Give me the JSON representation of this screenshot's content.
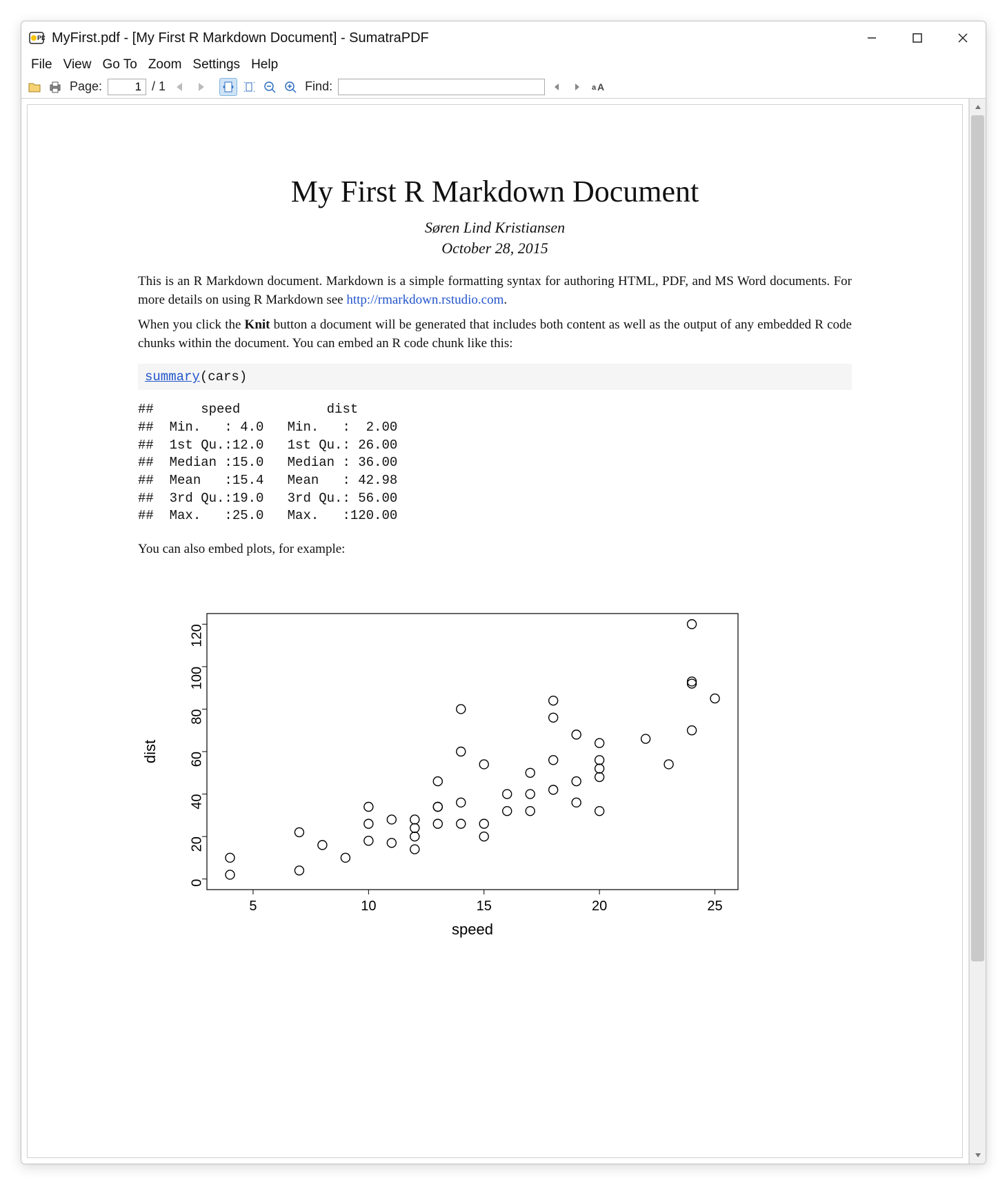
{
  "window": {
    "title": "MyFirst.pdf - [My First R Markdown Document] - SumatraPDF"
  },
  "menu": {
    "file": "File",
    "view": "View",
    "goto": "Go To",
    "zoom": "Zoom",
    "settings": "Settings",
    "help": "Help"
  },
  "toolbar": {
    "page_label": "Page:",
    "page_current": "1",
    "page_total": "/ 1",
    "find_label": "Find:",
    "find_value": ""
  },
  "doc": {
    "title": "My First R Markdown Document",
    "author": "Søren Lind Kristiansen",
    "date": "October 28, 2015",
    "p1a": "This is an R Markdown document. Markdown is a simple formatting syntax for authoring HTML, PDF, and MS Word documents. For more details on using R Markdown see ",
    "link_text": "http://rmarkdown.rstudio.com",
    "p1b": ".",
    "p2a": "When you click the ",
    "knit": "Knit",
    "p2b": " button a document will be generated that includes both content as well as the output of any embedded R code chunks within the document. You can embed an R code chunk like this:",
    "code_fn": "summary",
    "code_rest": "(cars)",
    "output": "##      speed           dist\n##  Min.   : 4.0   Min.   :  2.00\n##  1st Qu.:12.0   1st Qu.: 26.00\n##  Median :15.0   Median : 36.00\n##  Mean   :15.4   Mean   : 42.98\n##  3rd Qu.:19.0   3rd Qu.: 56.00\n##  Max.   :25.0   Max.   :120.00",
    "p3": "You can also embed plots, for example:"
  },
  "chart_data": {
    "type": "scatter",
    "xlabel": "speed",
    "ylabel": "dist",
    "xlim": [
      3,
      26
    ],
    "ylim": [
      -5,
      125
    ],
    "xticks": [
      5,
      10,
      15,
      20,
      25
    ],
    "yticks": [
      0,
      20,
      40,
      60,
      80,
      100,
      120
    ],
    "points": [
      {
        "x": 4,
        "y": 2
      },
      {
        "x": 4,
        "y": 10
      },
      {
        "x": 7,
        "y": 4
      },
      {
        "x": 7,
        "y": 22
      },
      {
        "x": 8,
        "y": 16
      },
      {
        "x": 9,
        "y": 10
      },
      {
        "x": 10,
        "y": 18
      },
      {
        "x": 10,
        "y": 26
      },
      {
        "x": 10,
        "y": 34
      },
      {
        "x": 11,
        "y": 17
      },
      {
        "x": 11,
        "y": 28
      },
      {
        "x": 12,
        "y": 14
      },
      {
        "x": 12,
        "y": 20
      },
      {
        "x": 12,
        "y": 24
      },
      {
        "x": 12,
        "y": 28
      },
      {
        "x": 13,
        "y": 26
      },
      {
        "x": 13,
        "y": 34
      },
      {
        "x": 13,
        "y": 34
      },
      {
        "x": 13,
        "y": 46
      },
      {
        "x": 14,
        "y": 26
      },
      {
        "x": 14,
        "y": 36
      },
      {
        "x": 14,
        "y": 60
      },
      {
        "x": 14,
        "y": 80
      },
      {
        "x": 15,
        "y": 20
      },
      {
        "x": 15,
        "y": 26
      },
      {
        "x": 15,
        "y": 54
      },
      {
        "x": 16,
        "y": 32
      },
      {
        "x": 16,
        "y": 40
      },
      {
        "x": 17,
        "y": 32
      },
      {
        "x": 17,
        "y": 40
      },
      {
        "x": 17,
        "y": 50
      },
      {
        "x": 18,
        "y": 42
      },
      {
        "x": 18,
        "y": 56
      },
      {
        "x": 18,
        "y": 76
      },
      {
        "x": 18,
        "y": 84
      },
      {
        "x": 19,
        "y": 36
      },
      {
        "x": 19,
        "y": 46
      },
      {
        "x": 19,
        "y": 68
      },
      {
        "x": 20,
        "y": 32
      },
      {
        "x": 20,
        "y": 48
      },
      {
        "x": 20,
        "y": 52
      },
      {
        "x": 20,
        "y": 56
      },
      {
        "x": 20,
        "y": 64
      },
      {
        "x": 22,
        "y": 66
      },
      {
        "x": 23,
        "y": 54
      },
      {
        "x": 24,
        "y": 70
      },
      {
        "x": 24,
        "y": 92
      },
      {
        "x": 24,
        "y": 93
      },
      {
        "x": 24,
        "y": 120
      },
      {
        "x": 25,
        "y": 85
      }
    ]
  }
}
